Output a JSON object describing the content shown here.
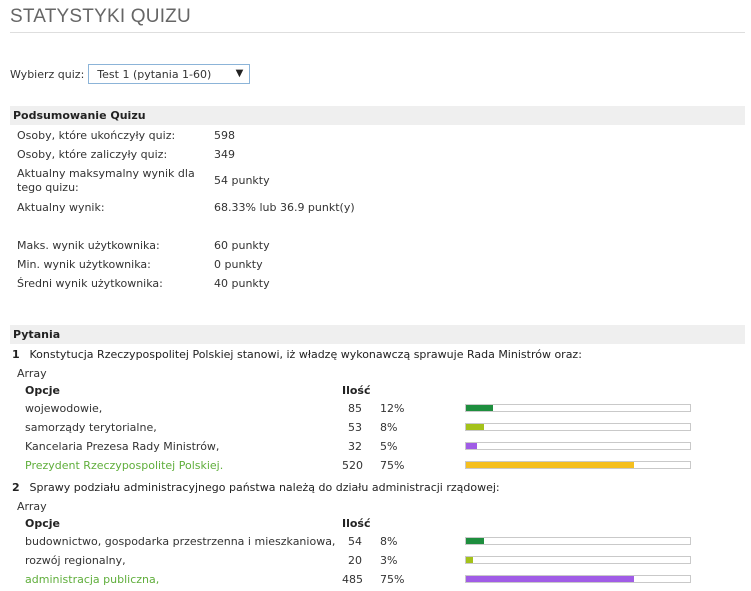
{
  "page_title": "STATYSTYKI QUIZU",
  "quiz_select": {
    "label": "Wybierz quiz:",
    "selected": "Test 1 (pytania 1-60)"
  },
  "summary": {
    "heading": "Podsumowanie Quizu",
    "rows": [
      {
        "label": "Osoby, które ukończyły quiz:",
        "value": "598"
      },
      {
        "label": "Osoby, które zaliczyły quiz:",
        "value": "349"
      },
      {
        "label": "Aktualny maksymalny wynik dla tego quizu:",
        "value": "54 punkty"
      },
      {
        "label": "Aktualny wynik:",
        "value": "68.33% lub 36.9 punkt(y)"
      },
      {
        "label": "Maks. wynik użytkownika:",
        "value": "60 punkty"
      },
      {
        "label": "Min. wynik użytkownika:",
        "value": "0 punkty"
      },
      {
        "label": "Średni wynik użytkownika:",
        "value": "40 punkty"
      }
    ]
  },
  "questions_heading": "Pytania",
  "questions": [
    {
      "number": "1",
      "text": "Konstytucja Rzeczypospolitej Polskiej stanowi, iż władzę wykonawczą sprawuje Rada Ministrów oraz:",
      "array_label": "Array",
      "col_options": "Opcje",
      "col_count": "Ilość",
      "options": [
        {
          "text": "wojewodowie,",
          "count": "85",
          "pct": "12%",
          "fraction": 0.12,
          "color": "#1e8e3e",
          "correct": false
        },
        {
          "text": "samorządy terytorialne,",
          "count": "53",
          "pct": "8%",
          "fraction": 0.08,
          "color": "#a4c21a",
          "correct": false
        },
        {
          "text": "Kancelaria Prezesa Rady Ministrów,",
          "count": "32",
          "pct": "5%",
          "fraction": 0.05,
          "color": "#a05ce6",
          "correct": false
        },
        {
          "text": "Prezydent Rzeczypospolitej Polskiej.",
          "count": "520",
          "pct": "75%",
          "fraction": 0.75,
          "color": "#f5bf1e",
          "correct": true
        }
      ]
    },
    {
      "number": "2",
      "text": "Sprawy podziału administracyjnego państwa należą do działu administracji rządowej:",
      "array_label": "Array",
      "col_options": "Opcje",
      "col_count": "Ilość",
      "options": [
        {
          "text": "budownictwo, gospodarka przestrzenna i mieszkaniowa,",
          "count": "54",
          "pct": "8%",
          "fraction": 0.08,
          "color": "#1e8e3e",
          "correct": false
        },
        {
          "text": "rozwój regionalny,",
          "count": "20",
          "pct": "3%",
          "fraction": 0.03,
          "color": "#a4c21a",
          "correct": false
        },
        {
          "text": "administracja publiczna,",
          "count": "485",
          "pct": "75%",
          "fraction": 0.75,
          "color": "#a05ce6",
          "correct": true
        }
      ]
    }
  ]
}
